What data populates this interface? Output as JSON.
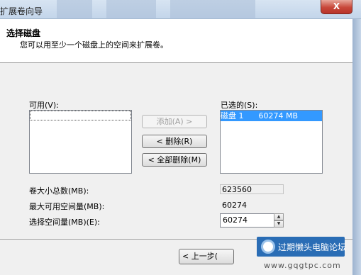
{
  "window": {
    "title": "扩展卷向导",
    "close_glyph": "X"
  },
  "header": {
    "title": "选择磁盘",
    "subtitle": "您可以用至少一个磁盘上的空间来扩展卷。"
  },
  "available": {
    "label": "可用(V):",
    "items": []
  },
  "selected": {
    "label": "已选的(S):",
    "items": [
      {
        "text": "磁盘 1      60274 MB"
      }
    ]
  },
  "buttons": {
    "add": "添加(A) >",
    "remove": "< 删除(R)",
    "remove_all": "< 全部删除(M)",
    "back": "< 上一步("
  },
  "fields": {
    "total_label": "卷大小总数(MB):",
    "total_value": "623560",
    "max_label": "最大可用空间量(MB):",
    "max_value": "60274",
    "select_label": "选择空间量(MB)(E):",
    "select_value": "60274"
  },
  "watermark": {
    "text": "过期懒头电脑论坛",
    "url": "www.gqgtpc.com"
  }
}
